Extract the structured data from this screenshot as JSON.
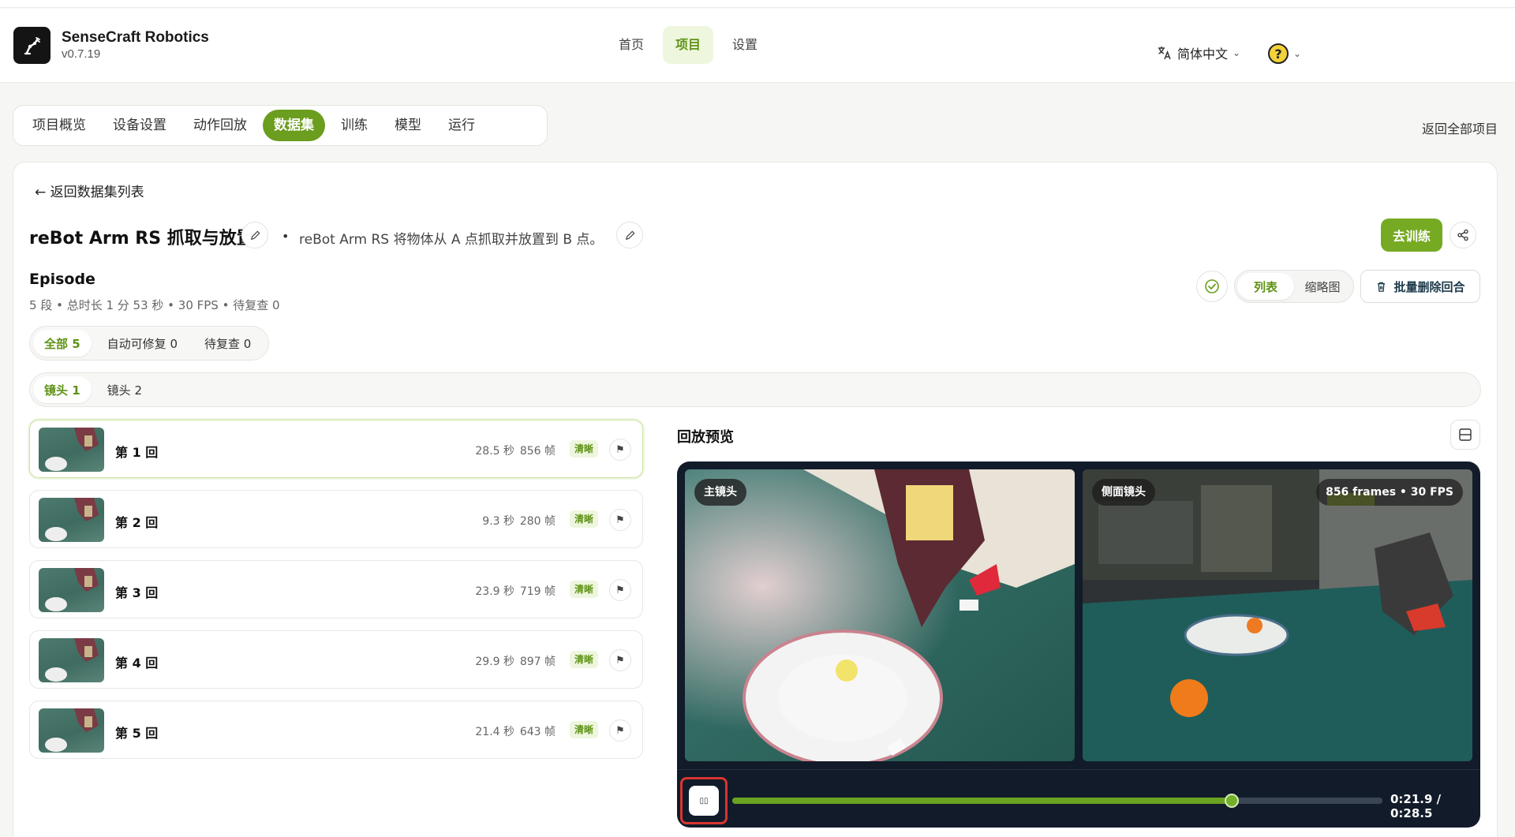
{
  "app": {
    "name": "SenseCraft Robotics",
    "version": "v0.7.19"
  },
  "nav": [
    {
      "label": "首页",
      "active": false
    },
    {
      "label": "项目",
      "active": true
    },
    {
      "label": "设置",
      "active": false
    }
  ],
  "language": {
    "label": "简体中文"
  },
  "tabs": [
    {
      "label": "项目概览",
      "active": false
    },
    {
      "label": "设备设置",
      "active": false
    },
    {
      "label": "动作回放",
      "active": false
    },
    {
      "label": "数据集",
      "active": true
    },
    {
      "label": "训练",
      "active": false
    },
    {
      "label": "模型",
      "active": false
    },
    {
      "label": "运行",
      "active": false
    }
  ],
  "back_all_projects": "返回全部项目",
  "back_to_list": "← 返回数据集列表",
  "dataset": {
    "title": "reBot Arm RS 抓取与放置",
    "separator": "•",
    "description": "reBot Arm RS 将物体从 A 点抓取并放置到 B 点。",
    "train_button": "去训练"
  },
  "episodes": {
    "title": "Episode",
    "meta": "5 段 • 总时长 1 分 53 秒 • 30 FPS • 待复查 0",
    "view_options": [
      {
        "label": "列表",
        "active": true
      },
      {
        "label": "缩略图",
        "active": false
      }
    ],
    "batch_delete": "批量删除回合",
    "filters": [
      {
        "label": "全部 5",
        "active": true
      },
      {
        "label": "自动可修复 0",
        "active": false
      },
      {
        "label": "待复查 0",
        "active": false
      }
    ],
    "cameras": [
      {
        "label": "镜头 1",
        "active": true
      },
      {
        "label": "镜头 2",
        "active": false
      }
    ],
    "items": [
      {
        "name": "第 1 回",
        "duration": "28.5 秒",
        "frames": "856 帧",
        "badge": "清晰",
        "active": true
      },
      {
        "name": "第 2 回",
        "duration": "9.3 秒",
        "frames": "280 帧",
        "badge": "清晰",
        "active": false
      },
      {
        "name": "第 3 回",
        "duration": "23.9 秒",
        "frames": "719 帧",
        "badge": "清晰",
        "active": false
      },
      {
        "name": "第 4 回",
        "duration": "29.9 秒",
        "frames": "897 帧",
        "badge": "清晰",
        "active": false
      },
      {
        "name": "第 5 回",
        "duration": "21.4 秒",
        "frames": "643 帧",
        "badge": "清晰",
        "active": false
      }
    ]
  },
  "preview": {
    "title": "回放预览",
    "cam_main": "主镜头",
    "cam_side": "侧面镜头",
    "frames_info": "856 frames • 30 FPS",
    "play_glyph": "▯▯",
    "progress_fraction": 0.7684,
    "time": "0:21.9 / 0:28.5"
  },
  "colors": {
    "accent": "#6b9d1e",
    "accent_light": "#eef6de",
    "player_bg": "#121b2a",
    "highlight": "#d8352f"
  }
}
